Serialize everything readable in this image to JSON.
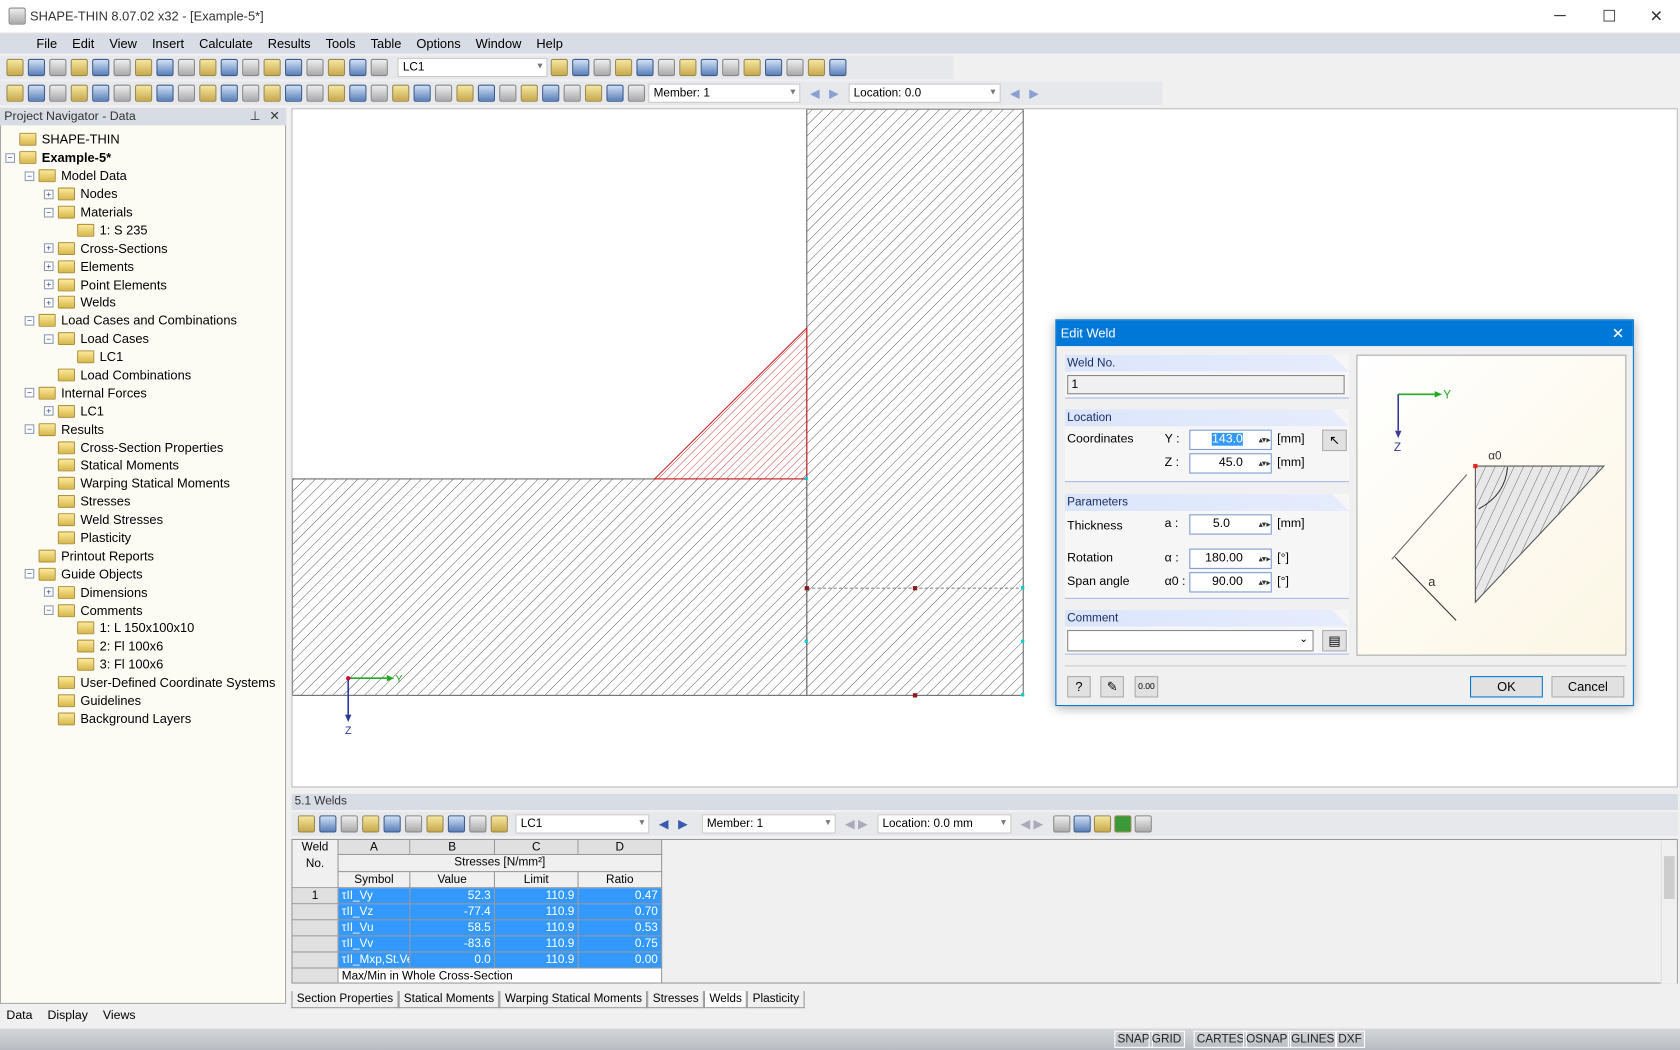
{
  "window": {
    "title": "SHAPE-THIN 8.07.02 x32 - [Example-5*]"
  },
  "menu": [
    "File",
    "Edit",
    "View",
    "Insert",
    "Calculate",
    "Results",
    "Tools",
    "Table",
    "Options",
    "Window",
    "Help"
  ],
  "toolbar": {
    "load_case": "LC1",
    "member": "Member: 1",
    "location": "Location:  0.0"
  },
  "navigator": {
    "title": "Project Navigator - Data",
    "items": [
      {
        "label": "SHAPE-THIN",
        "depth": 0,
        "exp": ""
      },
      {
        "label": "Example-5*",
        "depth": 0,
        "exp": "-",
        "bold": true
      },
      {
        "label": "Model Data",
        "depth": 1,
        "exp": "-"
      },
      {
        "label": "Nodes",
        "depth": 2,
        "exp": "+"
      },
      {
        "label": "Materials",
        "depth": 2,
        "exp": "-"
      },
      {
        "label": "1: S 235",
        "depth": 3,
        "exp": ""
      },
      {
        "label": "Cross-Sections",
        "depth": 2,
        "exp": "+"
      },
      {
        "label": "Elements",
        "depth": 2,
        "exp": "+"
      },
      {
        "label": "Point Elements",
        "depth": 2,
        "exp": "+"
      },
      {
        "label": "Welds",
        "depth": 2,
        "exp": "+"
      },
      {
        "label": "Load Cases and Combinations",
        "depth": 1,
        "exp": "-"
      },
      {
        "label": "Load Cases",
        "depth": 2,
        "exp": "-"
      },
      {
        "label": "LC1",
        "depth": 3,
        "exp": ""
      },
      {
        "label": "Load Combinations",
        "depth": 2,
        "exp": ""
      },
      {
        "label": "Internal Forces",
        "depth": 1,
        "exp": "-"
      },
      {
        "label": "LC1",
        "depth": 2,
        "exp": "+"
      },
      {
        "label": "Results",
        "depth": 1,
        "exp": "-"
      },
      {
        "label": "Cross-Section Properties",
        "depth": 2,
        "exp": ""
      },
      {
        "label": "Statical Moments",
        "depth": 2,
        "exp": ""
      },
      {
        "label": "Warping Statical Moments",
        "depth": 2,
        "exp": ""
      },
      {
        "label": "Stresses",
        "depth": 2,
        "exp": ""
      },
      {
        "label": "Weld Stresses",
        "depth": 2,
        "exp": ""
      },
      {
        "label": "Plasticity",
        "depth": 2,
        "exp": ""
      },
      {
        "label": "Printout Reports",
        "depth": 1,
        "exp": ""
      },
      {
        "label": "Guide Objects",
        "depth": 1,
        "exp": "-"
      },
      {
        "label": "Dimensions",
        "depth": 2,
        "exp": "+"
      },
      {
        "label": "Comments",
        "depth": 2,
        "exp": "-"
      },
      {
        "label": "1: L 150x100x10",
        "depth": 3,
        "exp": ""
      },
      {
        "label": "2: Fl 100x6",
        "depth": 3,
        "exp": ""
      },
      {
        "label": "3: Fl 100x6",
        "depth": 3,
        "exp": ""
      },
      {
        "label": "User-Defined Coordinate Systems",
        "depth": 2,
        "exp": ""
      },
      {
        "label": "Guidelines",
        "depth": 2,
        "exp": ""
      },
      {
        "label": "Background Layers",
        "depth": 2,
        "exp": ""
      }
    ],
    "tabs": [
      "Data",
      "Display",
      "Views"
    ]
  },
  "canvas": {
    "axis_y": "Y",
    "axis_z": "Z",
    "weld_color": "#cc2222"
  },
  "dialog": {
    "title": "Edit Weld",
    "weld_no_label": "Weld No.",
    "weld_no": "1",
    "location_label": "Location",
    "coordinates_label": "Coordinates",
    "y_label": "Y :",
    "y_value": "143.0",
    "z_label": "Z :",
    "z_value": "45.0",
    "unit_mm": "[mm]",
    "parameters_label": "Parameters",
    "thickness_label": "Thickness",
    "a_label": "a :",
    "thickness": "5.0",
    "rotation_label": "Rotation",
    "alpha_label": "α :",
    "rotation": "180.00",
    "unit_deg": "[°]",
    "span_label": "Span angle",
    "alpha0_label": "α0 :",
    "span": "90.00",
    "comment_label": "Comment",
    "comment": "",
    "ok": "OK",
    "cancel": "Cancel",
    "fig": {
      "y": "Y",
      "z": "Z",
      "a": "a",
      "alpha0": "α0"
    }
  },
  "panel": {
    "title": "5.1 Welds",
    "load_case": "LC1",
    "member": "Member: 1",
    "location": "Location:  0.0 mm",
    "cols": [
      "A",
      "B",
      "C",
      "D"
    ],
    "group_header": "Stresses [N/mm²]",
    "weld_no_header": "Weld No.",
    "headers": [
      "Symbol",
      "Value",
      "Limit",
      "Ratio"
    ],
    "rows": [
      {
        "no": "1",
        "symbol": "τII_Vy",
        "value": "52.3",
        "limit": "110.9",
        "ratio": "0.47"
      },
      {
        "no": "",
        "symbol": "τII_Vz",
        "value": "-77.4",
        "limit": "110.9",
        "ratio": "0.70"
      },
      {
        "no": "",
        "symbol": "τII_Vu",
        "value": "58.5",
        "limit": "110.9",
        "ratio": "0.53"
      },
      {
        "no": "",
        "symbol": "τII_Vv",
        "value": "-83.6",
        "limit": "110.9",
        "ratio": "0.75"
      },
      {
        "no": "",
        "symbol": "τII_Mxp,St.Ver",
        "value": "0.0",
        "limit": "110.9",
        "ratio": "0.00"
      }
    ],
    "footer": "Max/Min in Whole Cross-Section",
    "tabs": [
      "Section Properties",
      "Statical Moments",
      "Warping Statical Moments",
      "Stresses",
      "Welds",
      "Plasticity"
    ],
    "active_tab": "Welds"
  },
  "status": [
    "SNAP",
    "GRID",
    "CARTES",
    "OSNAP",
    "GLINES",
    "DXF"
  ]
}
